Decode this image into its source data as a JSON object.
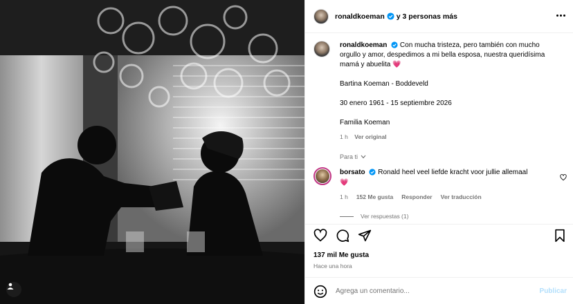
{
  "post": {
    "author": "ronaldkoeman",
    "collab_text": "y 3 personas más",
    "caption": {
      "username": "ronaldkoeman",
      "text": "Con mucha tristeza, pero también con mucho orgullo y amor, despedimos a mi bella esposa, nuestra queridísima mamá y abuelita",
      "emoji": "💗",
      "line1": "Bartina Koeman - Boddeveld",
      "line2": "30 enero 1961 - 15 septiembre 2026",
      "line3": "Familia Koeman",
      "time": "1 h",
      "see_original": "Ver original"
    },
    "para_ti": "Para ti",
    "comment": {
      "username": "borsato",
      "text": "Ronald heel veel liefde kracht voor jullie allemaal",
      "emoji": "💗",
      "time": "1 h",
      "likes": "152 Me gusta",
      "reply": "Responder",
      "translate": "Ver traducción",
      "replies": "Ver respuestas (1)"
    },
    "likes_count": "137 mil Me gusta",
    "posted": "Hace una hora",
    "comment_placeholder": "Agrega un comentario...",
    "publish": "Publicar"
  },
  "icons": [
    "heart-icon",
    "comment-icon",
    "share-icon",
    "save-icon",
    "emoji-icon",
    "more-icon",
    "verified-icon",
    "user-tag-icon",
    "chevron-down-icon"
  ],
  "colors": {
    "verified": "#0095f6",
    "publish_disabled": "#b2dffc",
    "muted": "#737373",
    "story_ring": "#c13584"
  }
}
